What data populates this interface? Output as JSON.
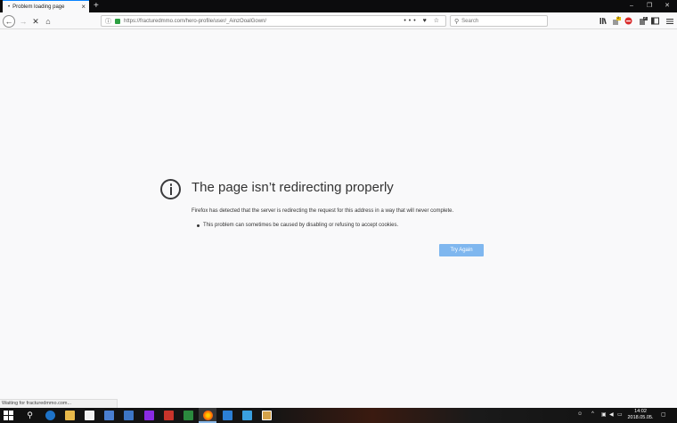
{
  "browser": {
    "tab": {
      "title": "Problem loading page",
      "dot": "•"
    },
    "new_tab": "+",
    "window_controls": {
      "minimize": "–",
      "maximize": "❐",
      "close": "✕"
    },
    "nav": {
      "back": "←",
      "forward": "→",
      "stop": "✕",
      "home": "⌂"
    },
    "url": "https://fracturedmmo.com/hero-profile/user/_AinzOoalGown/",
    "url_actions": "••• ♥ ☆",
    "search_placeholder": "Search"
  },
  "toolbar_badges": {
    "ext1_count": "2",
    "ext3_count": "2"
  },
  "error": {
    "title": "The page isn’t redirecting properly",
    "description": "Firefox has detected that the server is redirecting the request for this address in a way that will never complete.",
    "bullet": "This problem can sometimes be caused by disabling or refusing to accept cookies.",
    "button": "Try Again"
  },
  "status_text": "Waiting for fracturedmmo.com...",
  "taskbar": {
    "time": "14:02",
    "date": "2018.05.05.",
    "colors": {
      "accent": "#0a84ff",
      "try_again": "#7fb7ef"
    }
  }
}
